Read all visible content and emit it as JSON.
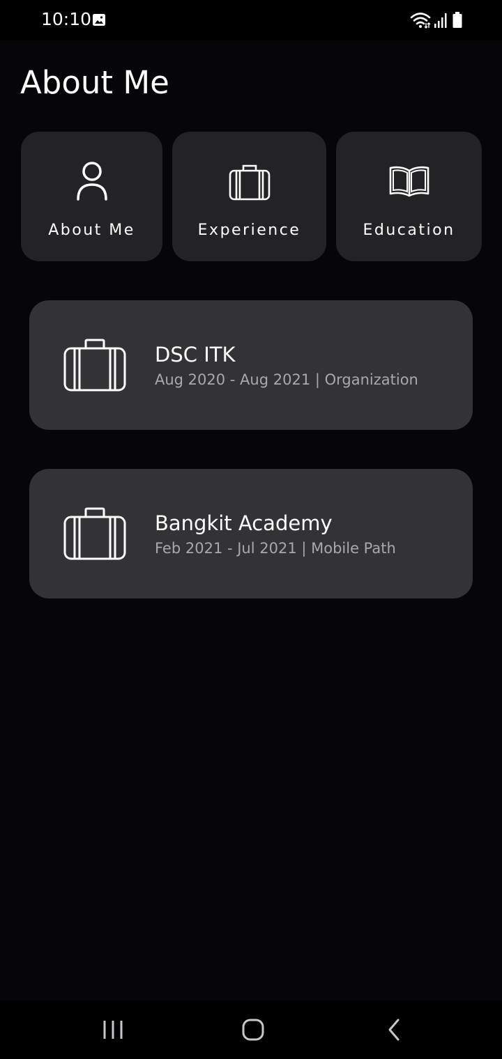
{
  "status_bar": {
    "time": "10:10",
    "icons": [
      "gallery-icon",
      "wifi-icon",
      "signal-icon",
      "battery-icon"
    ]
  },
  "header": {
    "title": "About Me"
  },
  "tabs": [
    {
      "label": "About Me",
      "icon": "person-icon"
    },
    {
      "label": "Experience",
      "icon": "briefcase-icon"
    },
    {
      "label": "Education",
      "icon": "book-icon"
    }
  ],
  "experiences": [
    {
      "title": "DSC ITK",
      "subtitle": "Aug 2020 - Aug 2021 | Organization",
      "icon": "briefcase-icon"
    },
    {
      "title": "Bangkit Academy",
      "subtitle": "Feb 2021 - Jul 2021 | Mobile Path",
      "icon": "briefcase-icon"
    }
  ],
  "nav_bar": {
    "buttons": [
      "recent-apps-icon",
      "home-icon",
      "back-icon"
    ]
  },
  "colors": {
    "background": "#060609",
    "tab_background": "#232325",
    "card_background": "#333335",
    "subtitle_text": "#a9a9ad",
    "text": "#ffffff"
  }
}
